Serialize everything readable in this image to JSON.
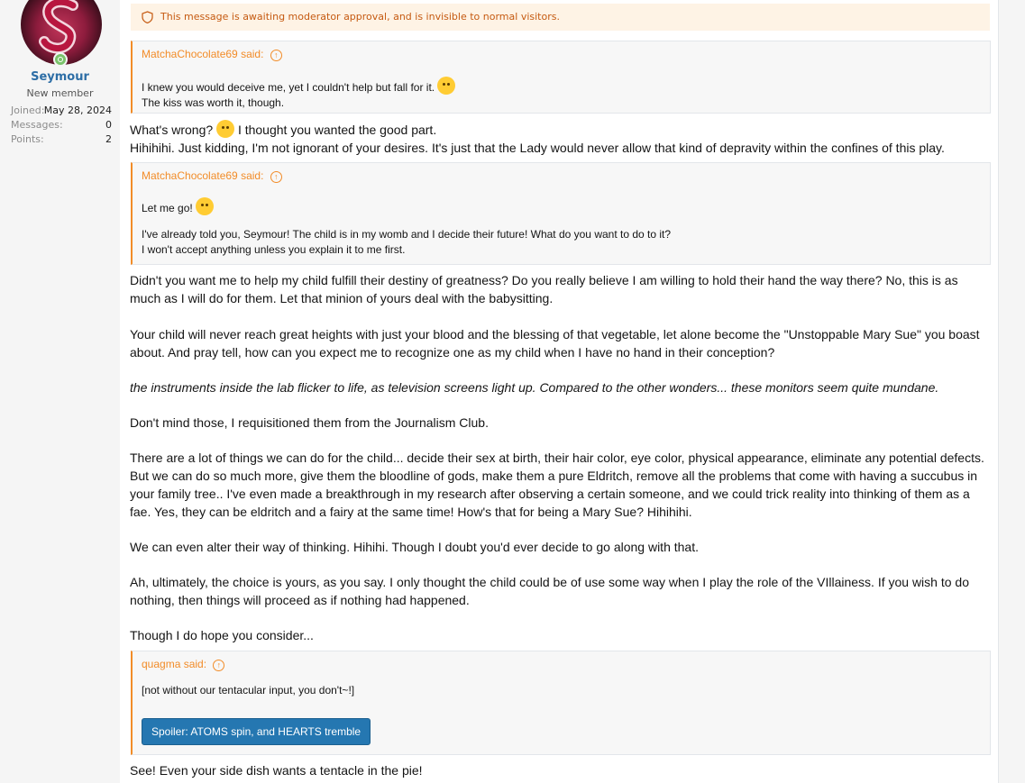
{
  "user": {
    "name": "Seymour",
    "title": "New member",
    "stats": [
      {
        "label": "Joined:",
        "value": "May 28, 2024"
      },
      {
        "label": "Messages:",
        "value": "0"
      },
      {
        "label": "Points:",
        "value": "2"
      }
    ],
    "online_color": "#7ac26b"
  },
  "moderation_notice": "This message is awaiting moderator approval, and is invisible to normal visitors.",
  "quote1": {
    "author": "MatchaChocolate69 said:",
    "arrow_icon": "↑",
    "line1": "I knew you would deceive me, yet I couldn't help but fall for it.",
    "line2": "The kiss was worth it, though."
  },
  "para1": {
    "a": "What's wrong?",
    "b": "I thought you wanted the good part.",
    "c": "Hihihihi. Just kidding, I'm not ignorant of your desires. It's just that the Lady would never allow that kind of depravity within the confines of this play."
  },
  "quote2": {
    "author": "MatchaChocolate69 said:",
    "line1": "Let me go!",
    "line2": "I've already told you, Seymour! The child is in my womb and I decide their future! What do you want to do to it?",
    "line3": "I won't accept anything unless you explain it to me first."
  },
  "paragraphs": [
    "Didn't you want me to help my child fulfill their destiny of greatness? Do you really believe I am willing to hold their hand the way there? No, this is as much as I will do for them. Let that minion of yours deal with the babysitting.",
    "Your child will never reach great heights with just your blood and the blessing of that vegetable, let alone become the \"Unstoppable Mary Sue\" you boast about. And pray tell, how can you expect me to recognize one as my child when I have no hand in their conception?",
    "the instruments inside the lab flicker to life, as television screens light up. Compared to the other wonders... these monitors seem quite mundane.",
    "Don't mind those, I requisitioned them from the Journalism Club.",
    "There are a lot of things we can do for the child... decide their sex at birth, their hair color, eye color, physical appearance, eliminate any potential defects. But we can do so much more, give them the bloodline of gods, make them a pure Eldritch, remove all the problems that come with having a succubus in your family tree.. I've even made a breakthrough in my research after observing a certain someone, and we could trick reality into thinking of them as a fae. Yes, they can be eldritch and a fairy at the same time! How's that for being a Mary Sue? Hihihihi.",
    "We can even alter their way of thinking. Hihihi. Though I doubt you'd ever decide to go along with that.",
    "Ah, ultimately, the choice is yours, as you say. I only thought the child could be of use some way when I play the role of the VIllainess. If you wish to do nothing, then things will proceed as if nothing had happened.",
    "Though I do hope you consider..."
  ],
  "quote3": {
    "author": "quagma said:",
    "line1": "[not without our tentacular input, you don't~!]",
    "spoiler_button": "Spoiler: ATOMS spin, and HEARTS tremble"
  },
  "final_para": "See! Even your side dish wants a tentacle in the pie!"
}
